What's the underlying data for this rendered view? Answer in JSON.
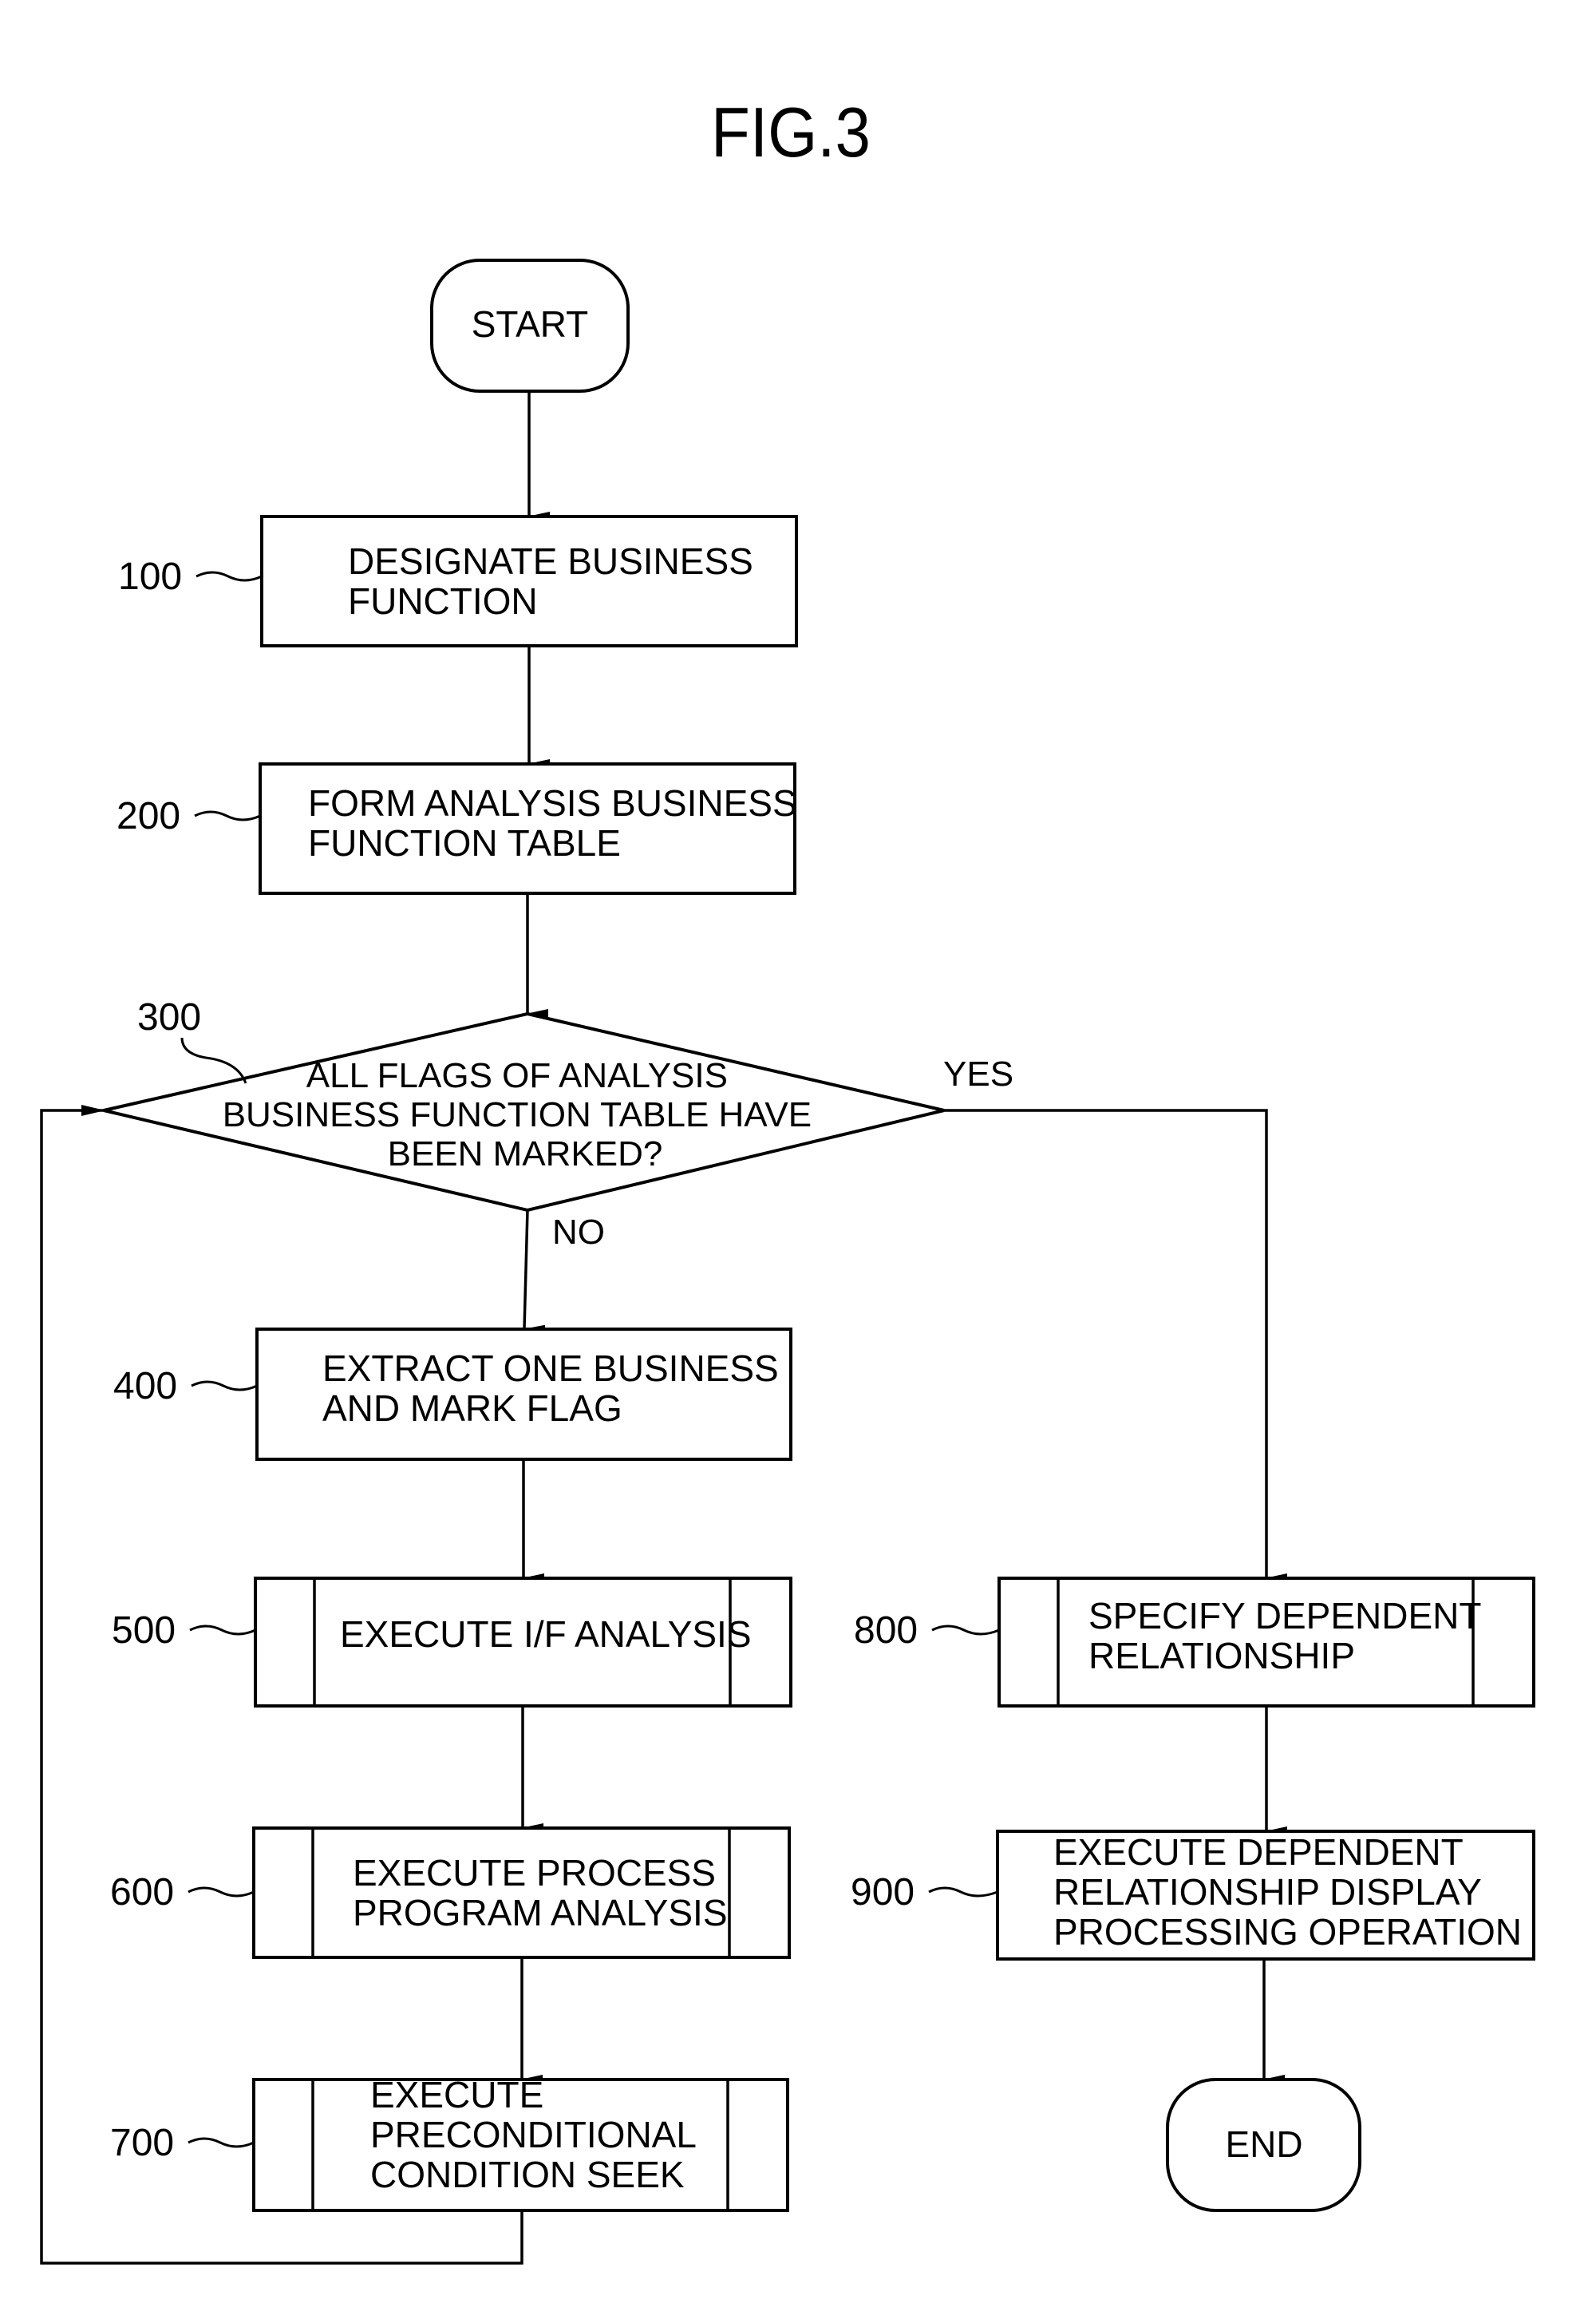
{
  "figure": {
    "title": "FIG.3",
    "nodes": {
      "start": {
        "label": "START"
      },
      "s100": {
        "ref": "100",
        "lines": [
          "DESIGNATE BUSINESS",
          "FUNCTION"
        ]
      },
      "s200": {
        "ref": "200",
        "lines": [
          "FORM ANALYSIS BUSINESS",
          "FUNCTION TABLE"
        ]
      },
      "s300": {
        "ref": "300",
        "lines": [
          "ALL FLAGS OF ANALYSIS",
          "BUSINESS FUNCTION TABLE HAVE",
          "BEEN MARKED?"
        ],
        "yes_label": "YES",
        "no_label": "NO"
      },
      "s400": {
        "ref": "400",
        "lines": [
          "EXTRACT ONE BUSINESS",
          "AND MARK FLAG"
        ]
      },
      "s500": {
        "ref": "500",
        "lines": [
          "EXECUTE I/F ANALYSIS"
        ]
      },
      "s600": {
        "ref": "600",
        "lines": [
          "EXECUTE PROCESS",
          "PROGRAM ANALYSIS"
        ]
      },
      "s700": {
        "ref": "700",
        "lines": [
          "EXECUTE",
          "PRECONDITIONAL",
          "CONDITION SEEK"
        ]
      },
      "s800": {
        "ref": "800",
        "lines": [
          "SPECIFY DEPENDENT",
          "RELATIONSHIP"
        ]
      },
      "s900": {
        "ref": "900",
        "lines": [
          "EXECUTE DEPENDENT",
          "RELATIONSHIP DISPLAY",
          "PROCESSING OPERATION"
        ]
      },
      "end": {
        "label": "END"
      }
    }
  }
}
